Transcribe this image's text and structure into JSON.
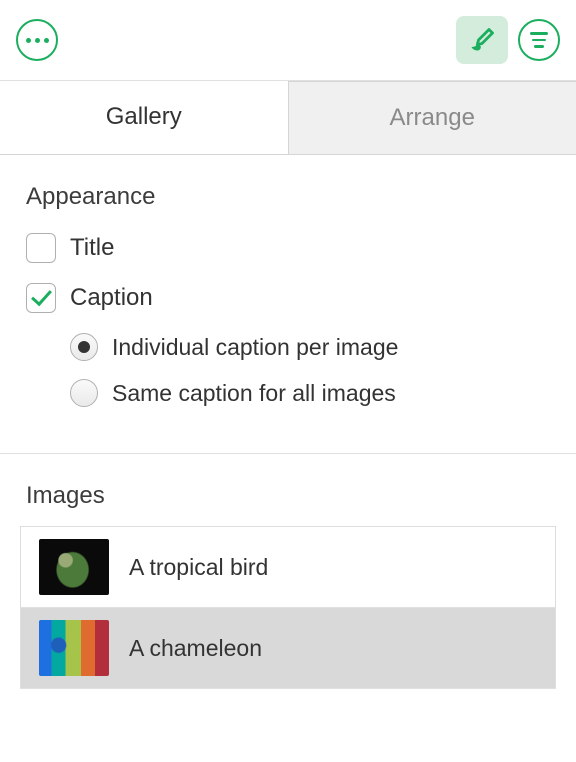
{
  "accent": "#1bae5f",
  "tabs": {
    "gallery": "Gallery",
    "arrange": "Arrange"
  },
  "appearance": {
    "title": "Appearance",
    "title_option": "Title",
    "caption_option": "Caption",
    "caption_modes": {
      "individual": "Individual caption per image",
      "same": "Same caption for all images"
    }
  },
  "images": {
    "title": "Images",
    "items": [
      {
        "label": "A tropical bird"
      },
      {
        "label": "A chameleon"
      }
    ]
  }
}
